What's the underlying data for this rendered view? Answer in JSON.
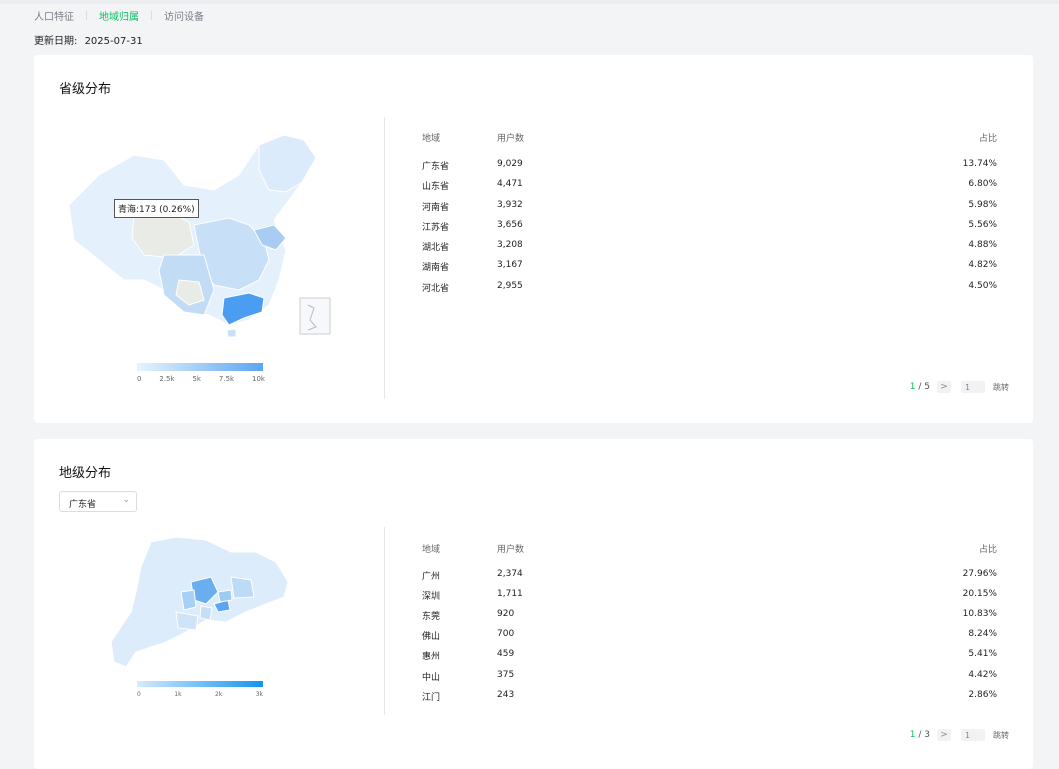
{
  "tabs": [
    {
      "label": "人口特征",
      "active": false
    },
    {
      "label": "地域归属",
      "active": true
    },
    {
      "label": "访问设备",
      "active": false
    }
  ],
  "update": {
    "label": "更新日期:",
    "date": "2025-07-31"
  },
  "province_card": {
    "title": "省级分布",
    "tooltip": "青海:173 (0.26%)",
    "legend_ticks": [
      "0",
      "2.5k",
      "5k",
      "7.5k",
      "10k"
    ],
    "headers": {
      "region": "地域",
      "users": "用户数",
      "share": "占比"
    },
    "rows": [
      {
        "name": "广东省",
        "users": "9,029",
        "share": "13.74%"
      },
      {
        "name": "山东省",
        "users": "4,471",
        "share": "6.80%"
      },
      {
        "name": "河南省",
        "users": "3,932",
        "share": "5.98%"
      },
      {
        "name": "江苏省",
        "users": "3,656",
        "share": "5.56%"
      },
      {
        "name": "湖北省",
        "users": "3,208",
        "share": "4.88%"
      },
      {
        "name": "湖南省",
        "users": "3,167",
        "share": "4.82%"
      },
      {
        "name": "河北省",
        "users": "2,955",
        "share": "4.50%"
      }
    ],
    "pager": {
      "current": "1",
      "sep": " / ",
      "total": "5",
      "next": ">",
      "input": "1",
      "jump": "跳转"
    }
  },
  "city_card": {
    "title": "地级分布",
    "select_value": "广东省",
    "legend_ticks": [
      "0",
      "1k",
      "2k",
      "3k"
    ],
    "headers": {
      "region": "地域",
      "users": "用户数",
      "share": "占比"
    },
    "rows": [
      {
        "name": "广州",
        "users": "2,374",
        "share": "27.96%"
      },
      {
        "name": "深圳",
        "users": "1,711",
        "share": "20.15%"
      },
      {
        "name": "东莞",
        "users": "920",
        "share": "10.83%"
      },
      {
        "name": "佛山",
        "users": "700",
        "share": "8.24%"
      },
      {
        "name": "惠州",
        "users": "459",
        "share": "5.41%"
      },
      {
        "name": "中山",
        "users": "375",
        "share": "4.42%"
      },
      {
        "name": "江门",
        "users": "243",
        "share": "2.86%"
      }
    ],
    "pager": {
      "current": "1",
      "sep": " / ",
      "total": "3",
      "next": ">",
      "input": "1",
      "jump": "跳转"
    }
  },
  "colors": {
    "accent": "#07c160",
    "map_high": "#4a9df0",
    "map_low": "#dcebfb"
  }
}
